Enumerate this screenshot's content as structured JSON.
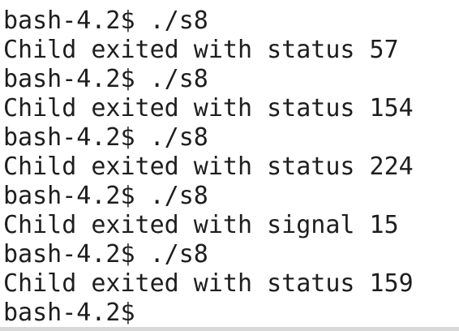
{
  "terminal": {
    "lines": [
      "bash-4.2$ ./s8",
      "Child exited with status 57",
      "bash-4.2$ ./s8",
      "Child exited with status 154",
      "bash-4.2$ ./s8",
      "Child exited with status 224",
      "bash-4.2$ ./s8",
      "Child exited with signal 15",
      "bash-4.2$ ./s8",
      "Child exited with status 159",
      "bash-4.2$"
    ]
  }
}
